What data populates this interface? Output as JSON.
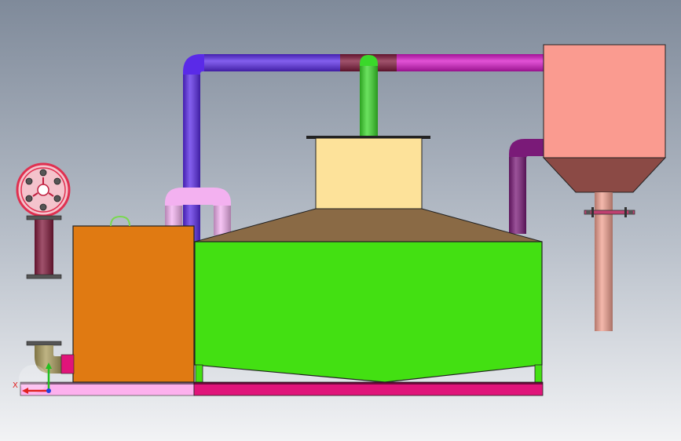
{
  "axis_triad": {
    "x_label": "X"
  },
  "colors": {
    "background_top": "#7f8a9a",
    "background_bottom": "#f2f3f5",
    "main_tank": "#43e012",
    "roof": "#8a6a45",
    "top_box": "#fde29a",
    "left_box": "#e07a12",
    "hopper_body": "#fa9b90",
    "hopper_cone": "#8b4a45",
    "pipe_blue": "#5a2ae8",
    "pipe_magenta": "#d818c8",
    "pipe_dark_red": "#80183a",
    "pipe_green": "#3ad82a",
    "pipe_pink": "#f3b1f0",
    "pipe_purple": "#7a1a78",
    "pipe_salmon": "#f0a090",
    "base_left": "#fdb0ee",
    "base_right": "#e0147a",
    "flange_red": "#e03050",
    "elbow_brass": "#a89a5a"
  }
}
